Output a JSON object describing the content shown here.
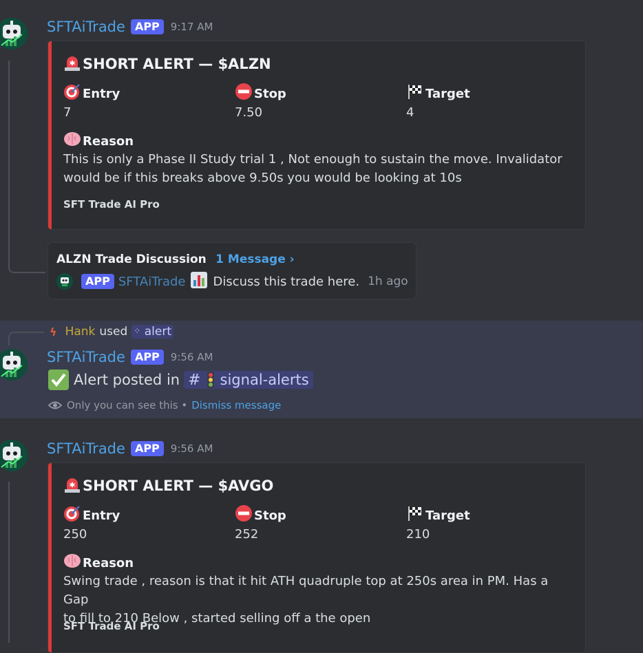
{
  "messages": [
    {
      "author": "SFTAiTrade",
      "badge": "APP",
      "time": "9:17 AM",
      "embed": {
        "title": "SHORT ALERT — $ALZN",
        "fields": {
          "entry_label": "Entry",
          "entry_value": "7",
          "stop_label": "Stop",
          "stop_value": "7.50",
          "target_label": "Target",
          "target_value": "4"
        },
        "reason_label": "Reason",
        "reason_line1": "This is only a Phase II Study trial 1 , Not enough to sustain the move. Invalidator",
        "reason_line2": "would be if this breaks above 9.50s you would be looking at 10s",
        "footer": "SFT Trade AI Pro"
      },
      "thread": {
        "name": "ALZN Trade Discussion",
        "count": "1 Message ›",
        "badge": "APP",
        "author": "SFTAiTrade",
        "preview": "Discuss this trade here.",
        "ago": "1h ago"
      }
    },
    {
      "command_user": "Hank",
      "command_used": "used",
      "command_name": "alert",
      "author": "SFTAiTrade",
      "badge": "APP",
      "time": "9:56 AM",
      "text_prefix": "Alert posted in",
      "channel_hash": "#",
      "channel": "signal-alerts",
      "ephemeral_note": "Only you can see this •",
      "dismiss": "Dismiss message"
    },
    {
      "author": "SFTAiTrade",
      "badge": "APP",
      "time": "9:56 AM",
      "embed": {
        "title": "SHORT ALERT — $AVGO",
        "fields": {
          "entry_label": "Entry",
          "entry_value": "250",
          "stop_label": "Stop",
          "stop_value": "252",
          "target_label": "Target",
          "target_value": "210"
        },
        "reason_label": "Reason",
        "reason_line1": "Swing trade , reason is that it hit ATH quadruple top at 250s area in PM. Has a Gap",
        "reason_line2": "to fill to 210 Below , started selling off a the open",
        "footer": "SFT Trade AI Pro"
      }
    }
  ],
  "colors": {
    "accent": "#da3a38",
    "username": "#4ea2e6",
    "badge": "#5865f2",
    "highlight": "#393c4c"
  },
  "icons": [
    "rotating-light-icon",
    "target-icon",
    "no-entry-icon",
    "checkered-flag-icon",
    "brain-icon",
    "bar-chart-icon",
    "check-mark-icon",
    "traffic-light-icon",
    "eye-icon",
    "bot-avatar"
  ]
}
